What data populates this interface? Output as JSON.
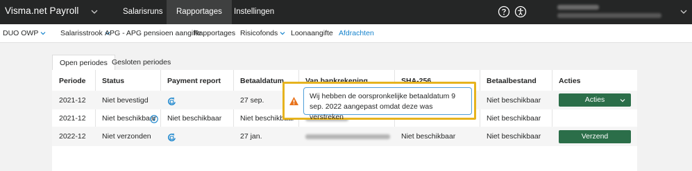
{
  "app": {
    "title": "Visma.net Payroll"
  },
  "topnav": {
    "items": [
      {
        "label": "Salarisruns"
      },
      {
        "label": "Rapportages"
      },
      {
        "label": "Instellingen"
      }
    ]
  },
  "subnav": {
    "items": [
      {
        "label": "DUO OWP"
      },
      {
        "label": "Salarisstrook"
      },
      {
        "label": "APG - APG pensioen aangifte"
      },
      {
        "label": "Rapportages"
      },
      {
        "label": "Risicofonds"
      },
      {
        "label": "Loonaangifte"
      },
      {
        "label": "Afdrachten"
      }
    ]
  },
  "tabs": [
    {
      "label": "Open periodes"
    },
    {
      "label": "Gesloten periodes"
    }
  ],
  "table": {
    "headers": [
      "Periode",
      "Status",
      "Payment report",
      "Betaaldatum",
      "Van bankrekening",
      "SHA-256",
      "Betaalbestand",
      "Acties"
    ],
    "rows": [
      {
        "periode": "2021-12",
        "status": "Niet bevestigd",
        "betaaldatum": "27 sep.",
        "betaalbestand": "Niet beschikbaar",
        "actie": "Acties"
      },
      {
        "periode": "2021-12",
        "status": "Niet beschikbaar",
        "payment_report": "Niet beschikbaar",
        "betaaldatum": "Niet beschikbaar",
        "betaalbestand": "Niet beschikbaar"
      },
      {
        "periode": "2022-12",
        "status": "Niet verzonden",
        "betaaldatum": "27 jan.",
        "sha": "Niet beschikbaar",
        "betaalbestand": "Niet beschikbaar",
        "actie": "Verzend"
      }
    ]
  },
  "tooltip": {
    "text": "Wij hebben de oorspronkelijke betaaldatum 9 sep. 2022 aangepast omdat deze was verstreken"
  },
  "colors": {
    "topbar": "#252626",
    "button": "#2b6e49",
    "link": "#1482cc",
    "highlight": "#e6b31e"
  }
}
